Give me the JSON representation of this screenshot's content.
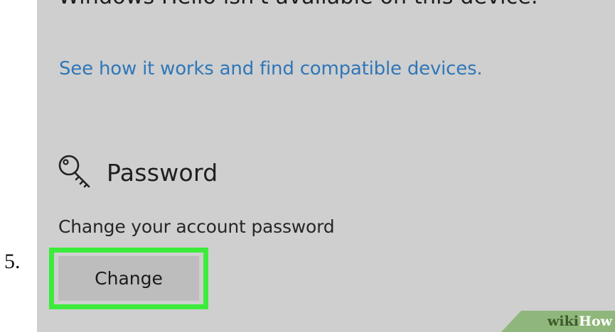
{
  "step_number": "5.",
  "settings": {
    "hello_message": "Windows Hello isn't available on this device.",
    "compat_link": "See how it works and find compatible devices.",
    "password": {
      "icon": "key-icon",
      "title": "Password",
      "description": "Change your account password",
      "change_button": "Change"
    }
  },
  "watermark": {
    "part1": "wiki",
    "part2": "How"
  },
  "colors": {
    "panel_background": "#cfcfcf",
    "link": "#2f77b8",
    "button_background": "#bdbdbd",
    "highlight": "#3bec3b",
    "watermark_background": "#8fb77b"
  }
}
